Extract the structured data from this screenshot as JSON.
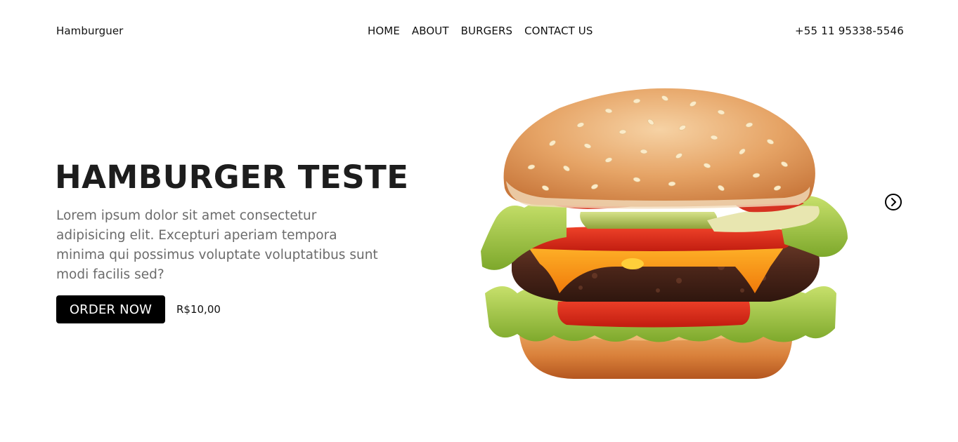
{
  "header": {
    "brand": "Hamburguer",
    "nav": [
      {
        "label": "HOME"
      },
      {
        "label": "ABOUT"
      },
      {
        "label": "BURGERS"
      },
      {
        "label": "CONTACT US"
      }
    ],
    "phone": "+55 11 95338-5546"
  },
  "hero": {
    "title": "HAMBURGER TESTE",
    "description": "Lorem ipsum dolor sit amet consectetur adipisicing elit. Excepturi aperiam tempora minima qui possimus voluptate voluptatibus sunt modi facilis sed?",
    "order_label": "ORDER NOW",
    "price": "R$10,00",
    "image_icon": "hamburger-image",
    "next_icon": "chevron-right-circle-icon"
  },
  "colors": {
    "accent": "#000000",
    "title": "#1d1d1d",
    "body_text": "#6b6b6b",
    "background": "#ffffff"
  }
}
